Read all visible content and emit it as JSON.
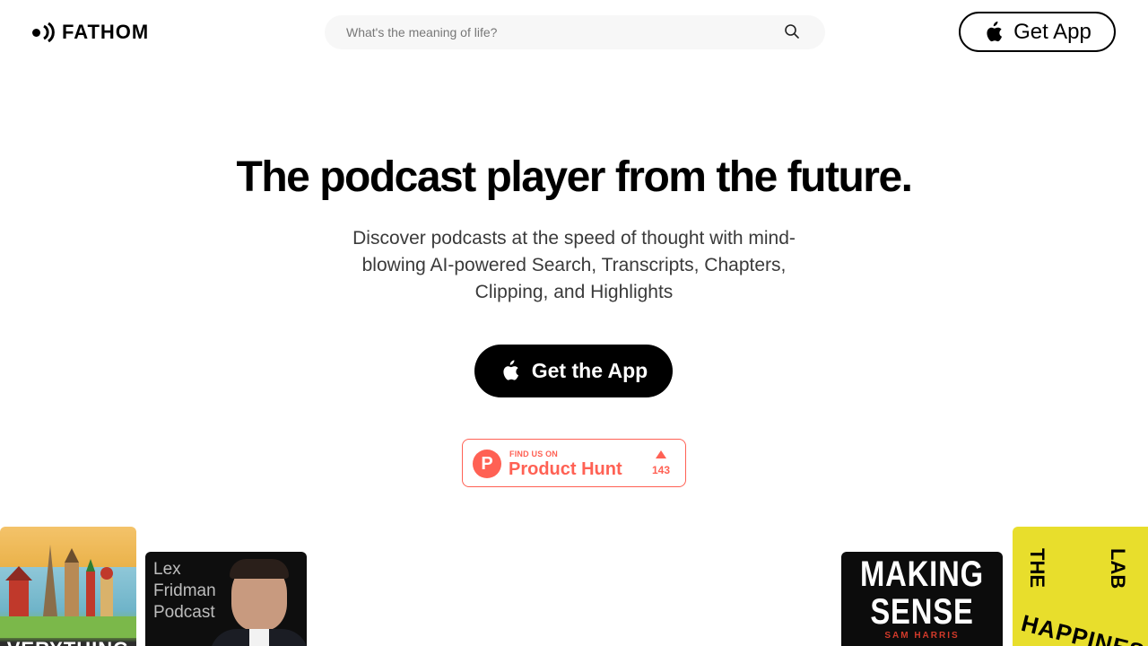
{
  "header": {
    "logo_text": "FATHOM",
    "search_placeholder": "What's the meaning of life?",
    "get_app_label": "Get App"
  },
  "hero": {
    "title": "The podcast player from the future.",
    "subtitle": "Discover podcasts at the speed of thought with mind-blowing AI-powered Search, Transcripts, Chapters, Clipping, and Highlights",
    "cta_label": "Get the App"
  },
  "product_hunt": {
    "kicker": "FIND US ON",
    "name": "Product Hunt",
    "logo_letter": "P",
    "votes": "143"
  },
  "covers": {
    "everything": {
      "text": "VERYTHING"
    },
    "lex": {
      "line1": "Lex",
      "line2": "Fridman",
      "line3": "Podcast"
    },
    "sam": {
      "title": "MAKING SENSE",
      "author": "SAM HARRIS"
    },
    "happiness": {
      "the": "THE",
      "lab": "LAB",
      "word": "HAPPINES"
    }
  },
  "colors": {
    "accent_product_hunt": "#ff6154",
    "cta_bg": "#000000",
    "search_bg": "#f7f7f7",
    "happiness_cover": "#e8de2c"
  },
  "icons": {
    "logo": "fathom-sound-icon",
    "search": "search-icon",
    "apple": "apple-icon",
    "upvote": "upvote-arrow-icon"
  }
}
